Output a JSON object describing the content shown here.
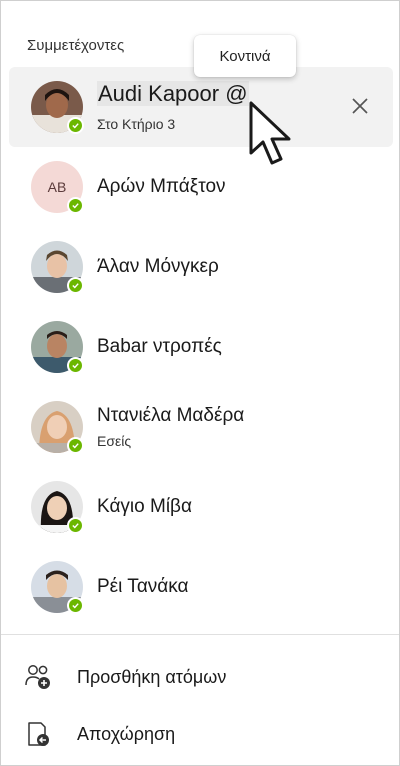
{
  "panel": {
    "section_title": "Συμμετέχοντες",
    "tooltip": "Κοντινά"
  },
  "participants": [
    {
      "name": "Audi Kapoor @",
      "status": "Στο Κτήριο 3",
      "avatar": "photo",
      "presence": "available"
    },
    {
      "name": "Αρών  Μπάξτον",
      "initials": "AB",
      "avatar": "initials",
      "presence": "available"
    },
    {
      "name": "Άλαν Μόνγκερ",
      "avatar": "photo",
      "presence": "available"
    },
    {
      "name": "Babar ντροπές",
      "avatar": "photo",
      "presence": "available"
    },
    {
      "name": "Ντανιέλα Μαδέρα",
      "status": "Εσείς",
      "avatar": "photo",
      "presence": "available"
    },
    {
      "name": "Κάγιο Μίβα",
      "avatar": "photo",
      "presence": "available"
    },
    {
      "name": "Ρέι Τανάκα",
      "avatar": "photo",
      "presence": "available"
    }
  ],
  "actions": {
    "add_people": "Προσθήκη ατόμων",
    "leave": "Αποχώρηση"
  },
  "icons": {
    "close": "close-icon",
    "add_people": "add-people-icon",
    "leave": "leave-icon",
    "presence": "checkmark-icon"
  },
  "colors": {
    "presence_available": "#6bb700",
    "row_highlight": "#f2f2f2",
    "initials_bg": "#f4d9d6"
  }
}
